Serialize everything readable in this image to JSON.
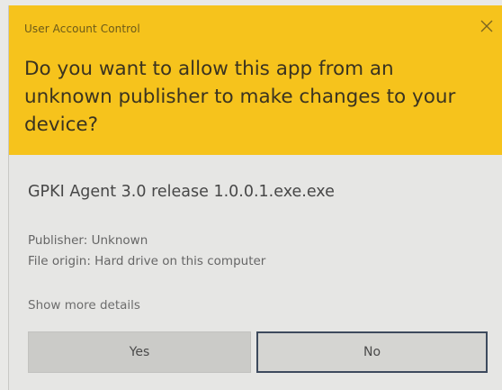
{
  "dialog": {
    "window_title": "User Account Control",
    "question": "Do you want to allow this app from an unknown publisher to make changes to your device?",
    "app_name": "GPKI Agent 3.0 release 1.0.0.1.exe.exe",
    "publisher": "Publisher: Unknown",
    "file_origin": "File origin: Hard drive on this computer",
    "show_more": "Show more details",
    "yes_label": "Yes",
    "no_label": "No"
  },
  "colors": {
    "header_bg": "#f6c31c",
    "body_bg": "#e6e6e4",
    "yes_bg": "#cbcbc8",
    "no_border": "#3d4a5d"
  },
  "icons": {
    "close": "close-icon"
  }
}
